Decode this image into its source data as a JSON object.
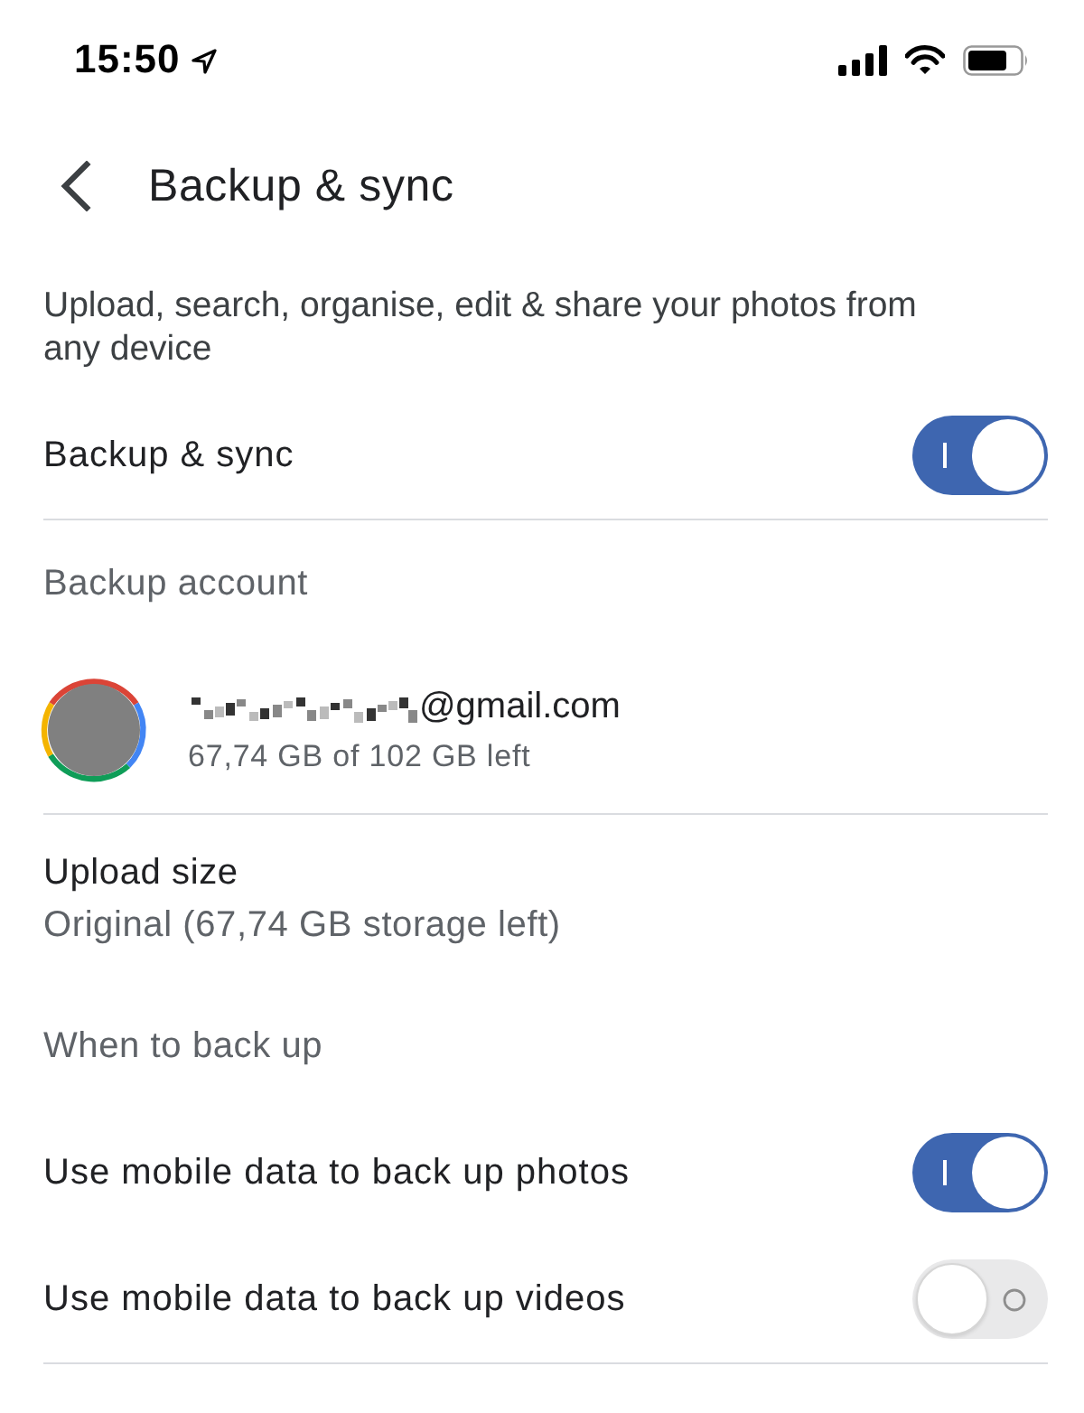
{
  "status_bar": {
    "time": "15:50"
  },
  "header": {
    "title": "Backup & sync"
  },
  "items": [
    {
      "kind": "description",
      "text": "Upload, search, organise, edit & share your photos from any device"
    },
    {
      "kind": "toggle",
      "label": "Backup & sync",
      "on": true
    },
    {
      "kind": "divider"
    },
    {
      "kind": "section_header",
      "label": "Backup account"
    },
    {
      "kind": "account",
      "email": "@gmail.com",
      "quota": "67,74 GB of 102 GB left"
    },
    {
      "kind": "divider"
    },
    {
      "kind": "setting",
      "label": "Upload size",
      "value": "Original (67,74 GB storage left)"
    },
    {
      "kind": "section_header",
      "label": "When to back up"
    },
    {
      "kind": "toggle",
      "label": "Use mobile data to back up photos",
      "on": true
    },
    {
      "kind": "toggle",
      "label": "Use mobile data to back up videos",
      "on": false
    },
    {
      "kind": "divider"
    }
  ]
}
